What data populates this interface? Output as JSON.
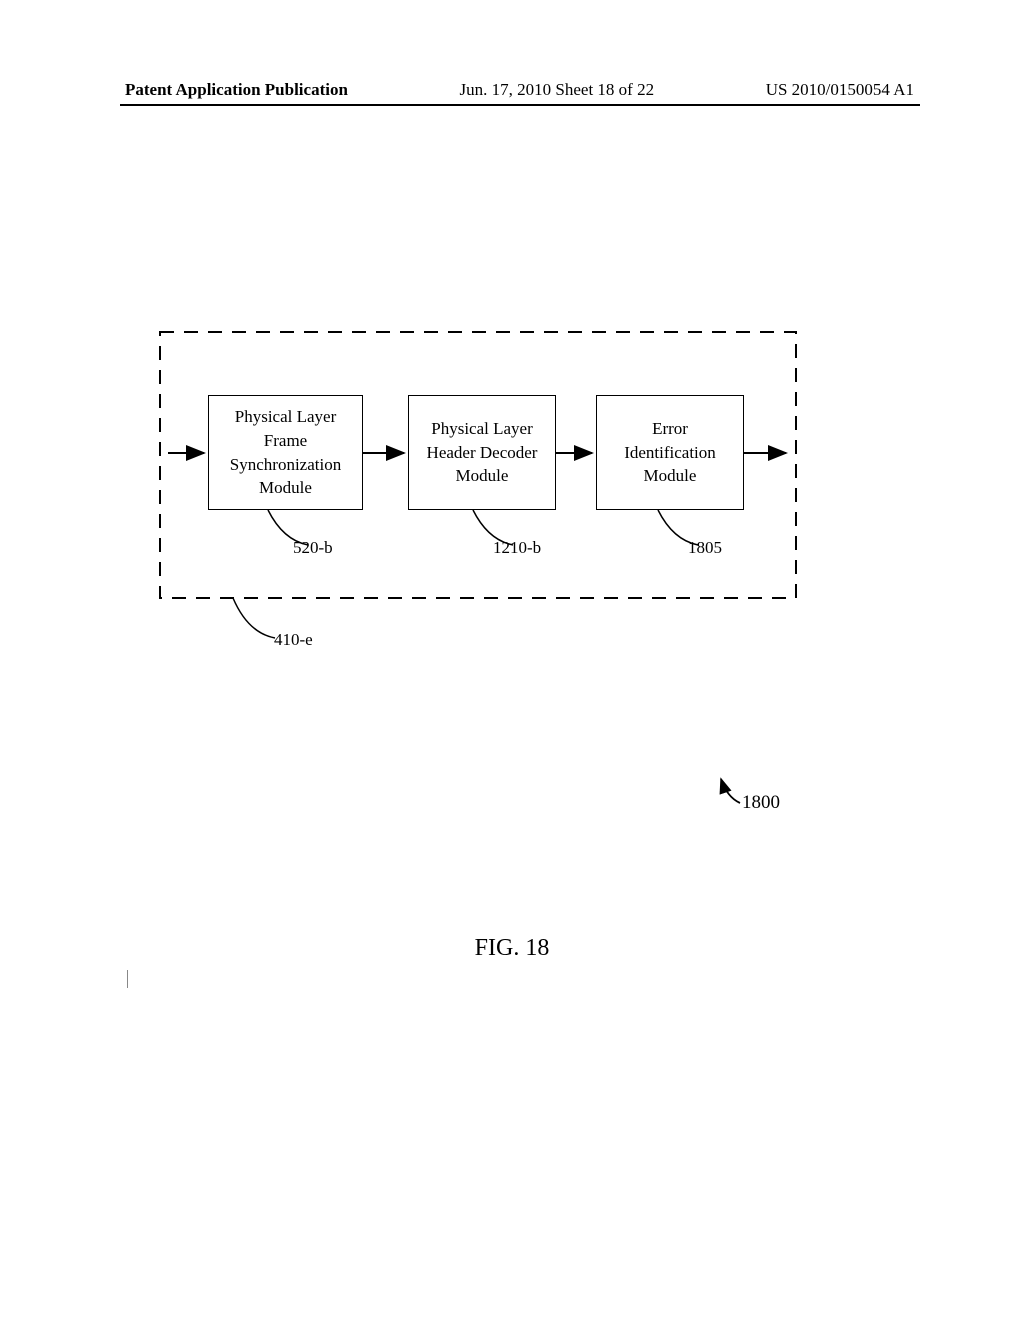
{
  "header": {
    "left": "Patent Application Publication",
    "center": "Jun. 17, 2010  Sheet 18 of 22",
    "right": "US 2010/0150054 A1"
  },
  "diagram": {
    "box1": {
      "line1": "Physical Layer",
      "line2": "Frame",
      "line3": "Synchronization",
      "line4": "Module"
    },
    "box2": {
      "line1": "Physical Layer",
      "line2": "Header Decoder",
      "line3": "Module"
    },
    "box3": {
      "line1": "Error",
      "line2": "Identification",
      "line3": "Module"
    },
    "ref1": "520-b",
    "ref2": "1210-b",
    "ref3": "1805",
    "ref4": "410-e",
    "ref1800": "1800"
  },
  "figure_label": "FIG. 18"
}
